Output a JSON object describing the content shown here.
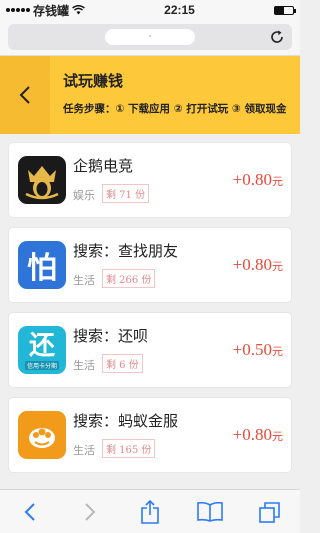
{
  "status_bar": {
    "carrier": "存钱罐",
    "time": "22:15"
  },
  "browser": {
    "url": "·"
  },
  "header": {
    "title": "试玩赚钱",
    "steps": "任务步骤：① 下载应用 ② 打开试玩 ③ 领取现金"
  },
  "tasks": [
    {
      "name": "企鹅电竞",
      "category": "娱乐",
      "remaining": "剩 71 份",
      "reward_prefix": "+",
      "reward": "0.80",
      "unit": "元",
      "icon": "penguin-esports-icon",
      "color": "#1a1a1a"
    },
    {
      "name": "搜索：查找朋友",
      "category": "生活",
      "remaining": "剩 266 份",
      "reward_prefix": "+",
      "reward": "0.80",
      "unit": "元",
      "icon": "pa-char-icon",
      "color": "#2f74d8"
    },
    {
      "name": "搜索：还呗",
      "category": "生活",
      "remaining": "剩 6 份",
      "reward_prefix": "+",
      "reward": "0.50",
      "unit": "元",
      "icon": "huan-char-icon",
      "color": "#22b7d6",
      "icon_text": "还",
      "icon_sub": "信用卡分期"
    },
    {
      "name": "搜索：蚂蚁金服",
      "category": "生活",
      "remaining": "剩 165 份",
      "reward_prefix": "+",
      "reward": "0.80",
      "unit": "元",
      "icon": "ant-financial-icon",
      "color": "#f29b1b"
    }
  ],
  "icon_texts": {
    "pa": "怕"
  },
  "colors": {
    "header": "#fdc93a",
    "reward": "#e64a3b",
    "toolbar_icon": "#2b7cf6"
  }
}
